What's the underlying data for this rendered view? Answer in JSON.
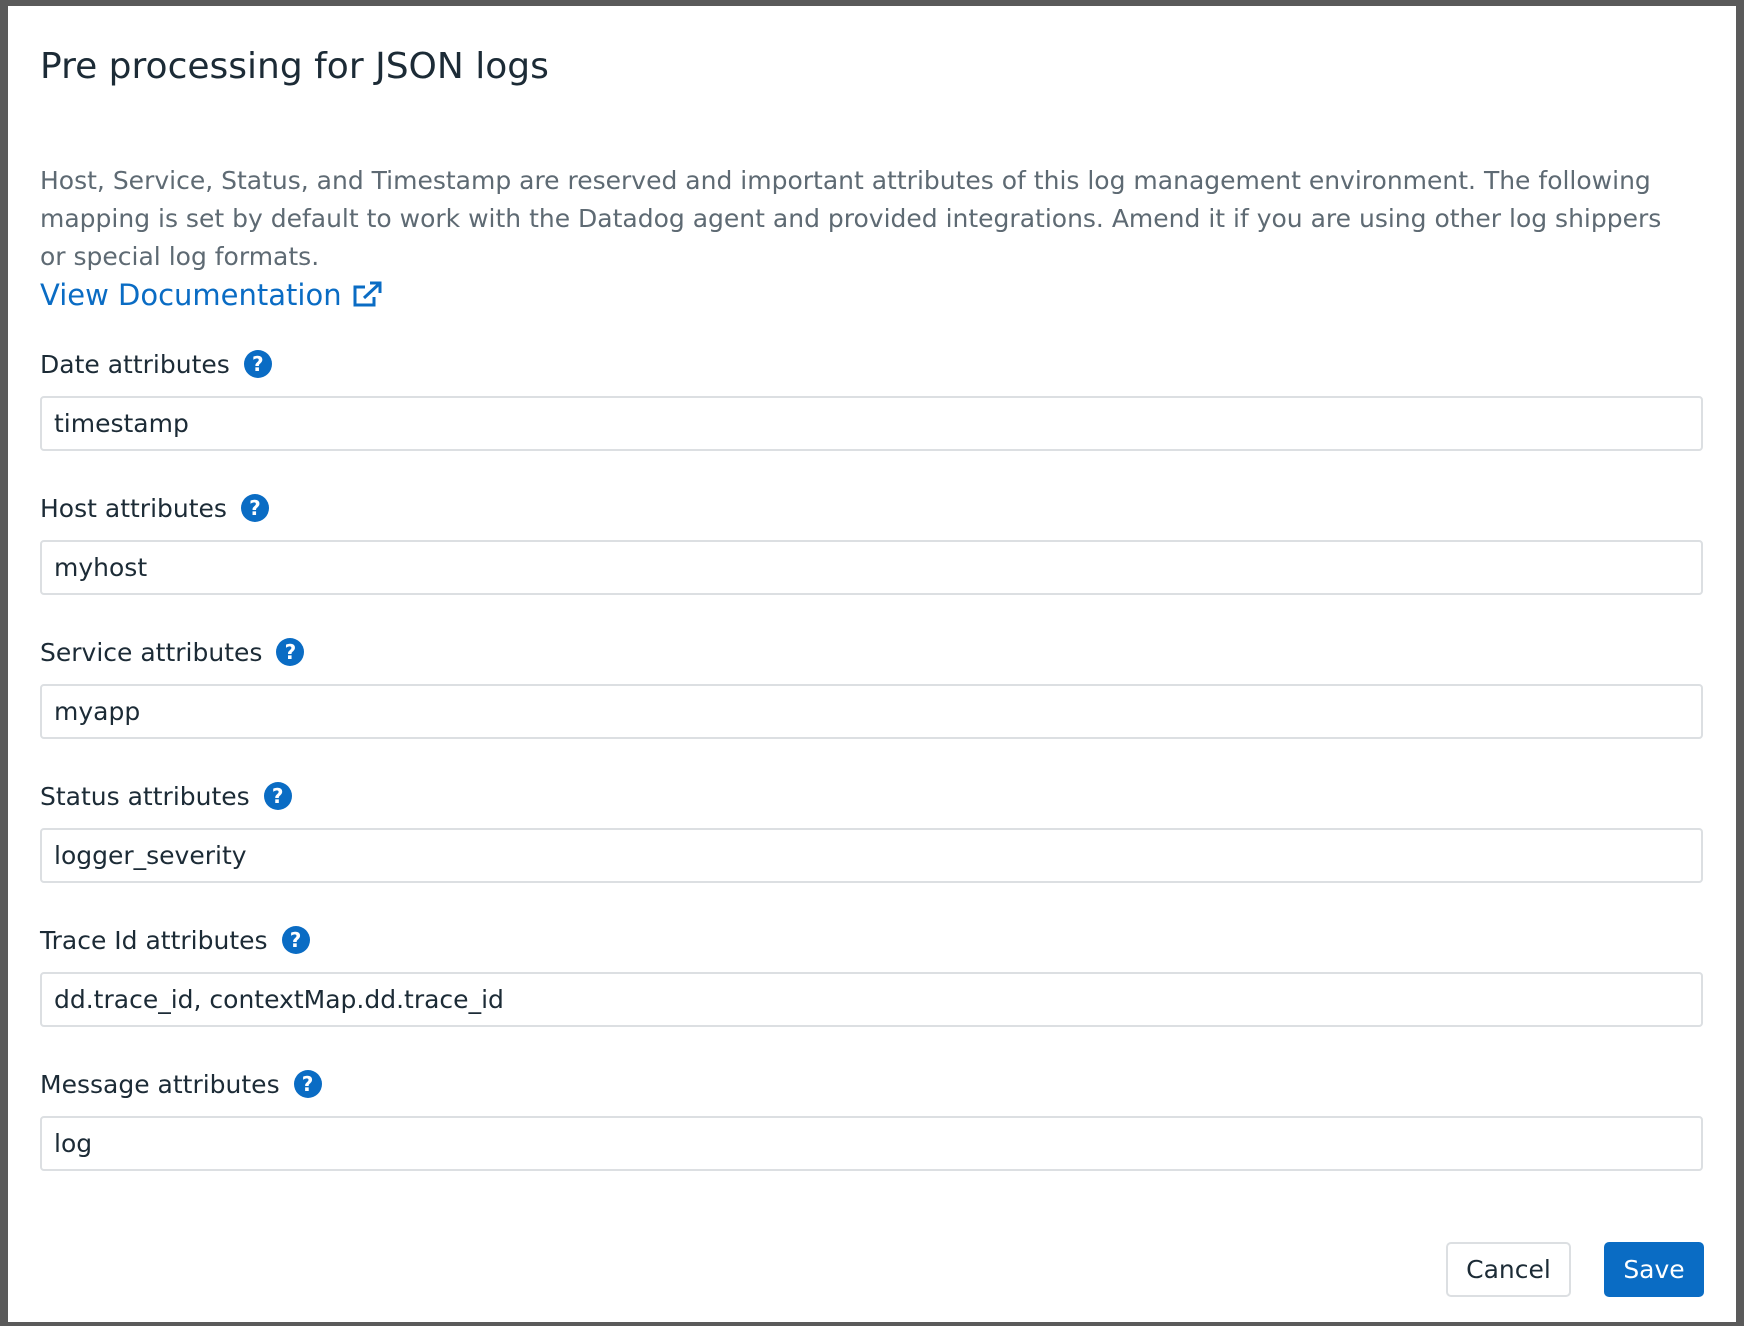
{
  "dialog": {
    "title": "Pre processing for JSON logs",
    "description": "Host, Service, Status, and Timestamp are reserved and important attributes of this log management environment. The following mapping is set by default to work with the Datadog agent and provided integrations. Amend it if you are using other log shippers or special log formats.",
    "doc_link": "View Documentation",
    "fields": [
      {
        "label": "Date attributes",
        "value": "timestamp"
      },
      {
        "label": "Host attributes",
        "value": "myhost"
      },
      {
        "label": "Service attributes",
        "value": "myapp"
      },
      {
        "label": "Status attributes",
        "value": "logger_severity"
      },
      {
        "label": "Trace Id attributes",
        "value": "dd.trace_id, contextMap.dd.trace_id"
      },
      {
        "label": "Message attributes",
        "value": "log"
      }
    ],
    "help_glyph": "?",
    "cancel_label": "Cancel",
    "save_label": "Save"
  }
}
